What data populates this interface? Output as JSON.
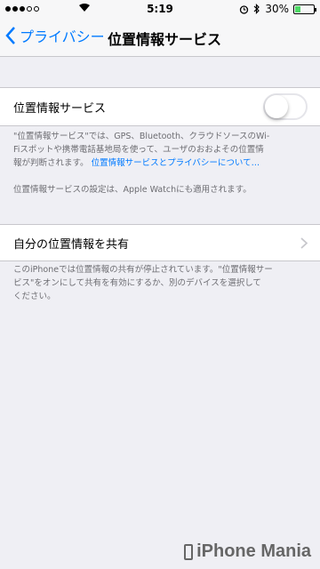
{
  "status": {
    "time": "5:19",
    "battery": "30%",
    "battery_level": 0.3
  },
  "nav": {
    "back_label": "プライバシー",
    "title": "位置情報サービス"
  },
  "location": {
    "label": "位置情報サービス",
    "toggle_on": false,
    "note_line1": "\"位置情報サービス\"では、GPS、Bluetooth、クラウドソースのWi-",
    "note_line2": "Fiスポットや携帯電話基地局を使って、ユーザのおおよその位置情",
    "note_line3": "報が判断されます。",
    "link": "位置情報サービスとプライバシーについて…",
    "apple_watch_note": "位置情報サービスの設定は、Apple Watchにも適用されます。"
  },
  "share": {
    "label": "自分の位置情報を共有",
    "note_line1": "このiPhoneでは位置情報の共有が停止されています。\"位置情報サー",
    "note_line2": "ビス\"をオンにして共有を有効にするか、別のデバイスを選択して",
    "note_line3": "ください。"
  },
  "watermark": "iPhone Mania"
}
